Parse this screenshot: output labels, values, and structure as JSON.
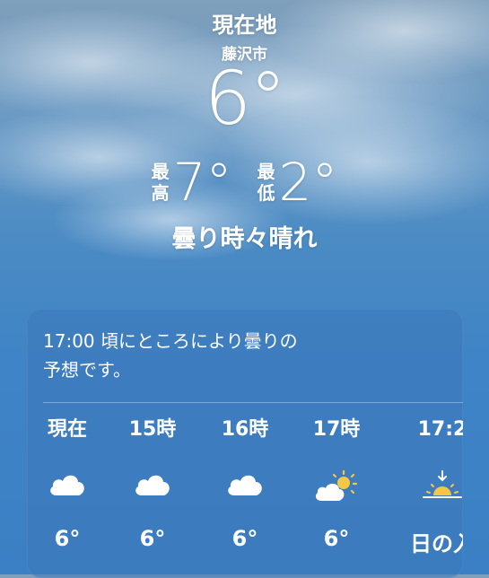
{
  "header": {
    "location_title": "現在地",
    "location_name": "藤沢市",
    "current_temp": "6°",
    "high_label_1": "最",
    "high_label_2": "高",
    "high_temp": "7°",
    "low_label_1": "最",
    "low_label_2": "低",
    "low_temp": "2°",
    "condition": "曇り時々晴れ"
  },
  "forecast": {
    "message_line1": "17:00 頃にところにより曇りの",
    "message_line2": "予想です。",
    "hours": [
      {
        "time": "現在",
        "icon": "cloud-icon",
        "temp": "6°"
      },
      {
        "time": "15時",
        "icon": "cloud-icon",
        "temp": "6°"
      },
      {
        "time": "16時",
        "icon": "cloud-icon",
        "temp": "6°"
      },
      {
        "time": "17時",
        "icon": "partly-sunny-icon",
        "temp": "6°"
      },
      {
        "time": "17:2",
        "icon": "sunset-icon",
        "temp": "日の入"
      }
    ]
  },
  "colors": {
    "sun": "#f6c744",
    "text": "#ffffff"
  }
}
